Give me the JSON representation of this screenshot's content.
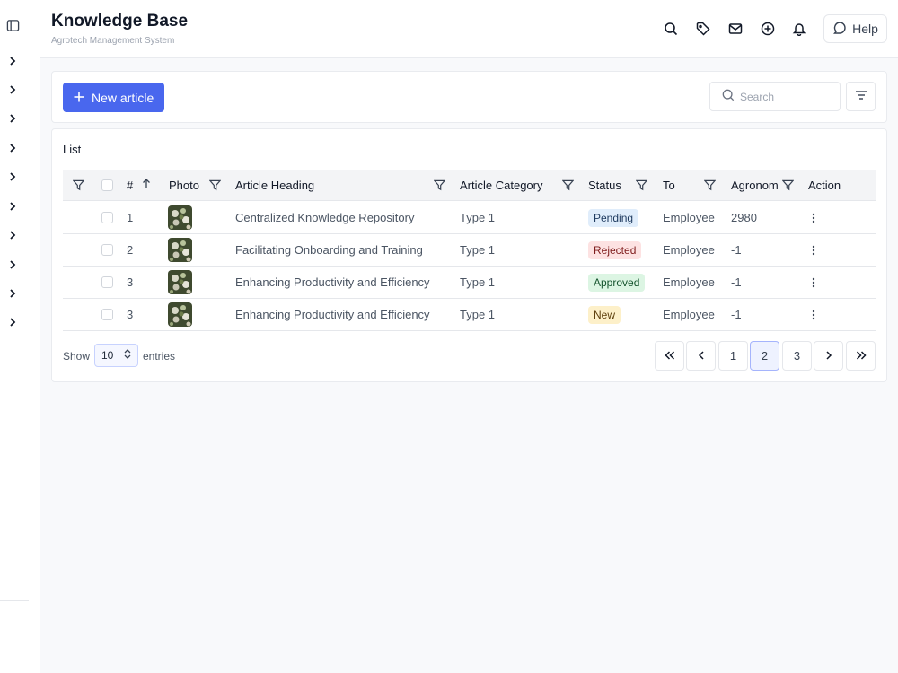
{
  "header": {
    "title": "Knowledge Base",
    "subtitle": "Agrotech Management System",
    "help_label": "Help"
  },
  "toolbar": {
    "new_article_label": "New article",
    "search_placeholder": "Search"
  },
  "list": {
    "title": "List",
    "columns": {
      "num": "#",
      "photo": "Photo",
      "heading": "Article Heading",
      "category": "Article Category",
      "status": "Status",
      "to": "To",
      "agronom": "Agronom",
      "action": "Action"
    },
    "rows": [
      {
        "num": "1",
        "heading": "Centralized Knowledge Repository",
        "category": "Type 1",
        "status": "Pending",
        "to": "Employee",
        "agronom": "2980"
      },
      {
        "num": "2",
        "heading": "Facilitating Onboarding and Training",
        "category": "Type 1",
        "status": "Rejected",
        "to": "Employee",
        "agronom": "-1"
      },
      {
        "num": "3",
        "heading": "Enhancing Productivity and Efficiency",
        "category": "Type 1",
        "status": "Approved",
        "to": "Employee",
        "agronom": "-1"
      },
      {
        "num": "3",
        "heading": "Enhancing Productivity and Efficiency",
        "category": "Type 1",
        "status": "New",
        "to": "Employee",
        "agronom": "-1"
      }
    ]
  },
  "status_colors": {
    "Pending": {
      "bg": "#e0edfb",
      "fg": "#1e3a5f"
    },
    "Rejected": {
      "bg": "#fde2e2",
      "fg": "#7f1d1d"
    },
    "Approved": {
      "bg": "#dcf5e3",
      "fg": "#14532d"
    },
    "New": {
      "bg": "#fdf0c9",
      "fg": "#5c3d0a"
    }
  },
  "footer": {
    "show_label": "Show",
    "entries_value": "10",
    "entries_label": "entries",
    "pages": [
      "1",
      "2",
      "3"
    ],
    "current_page": "2"
  },
  "colors": {
    "accent": "#4967ee"
  }
}
